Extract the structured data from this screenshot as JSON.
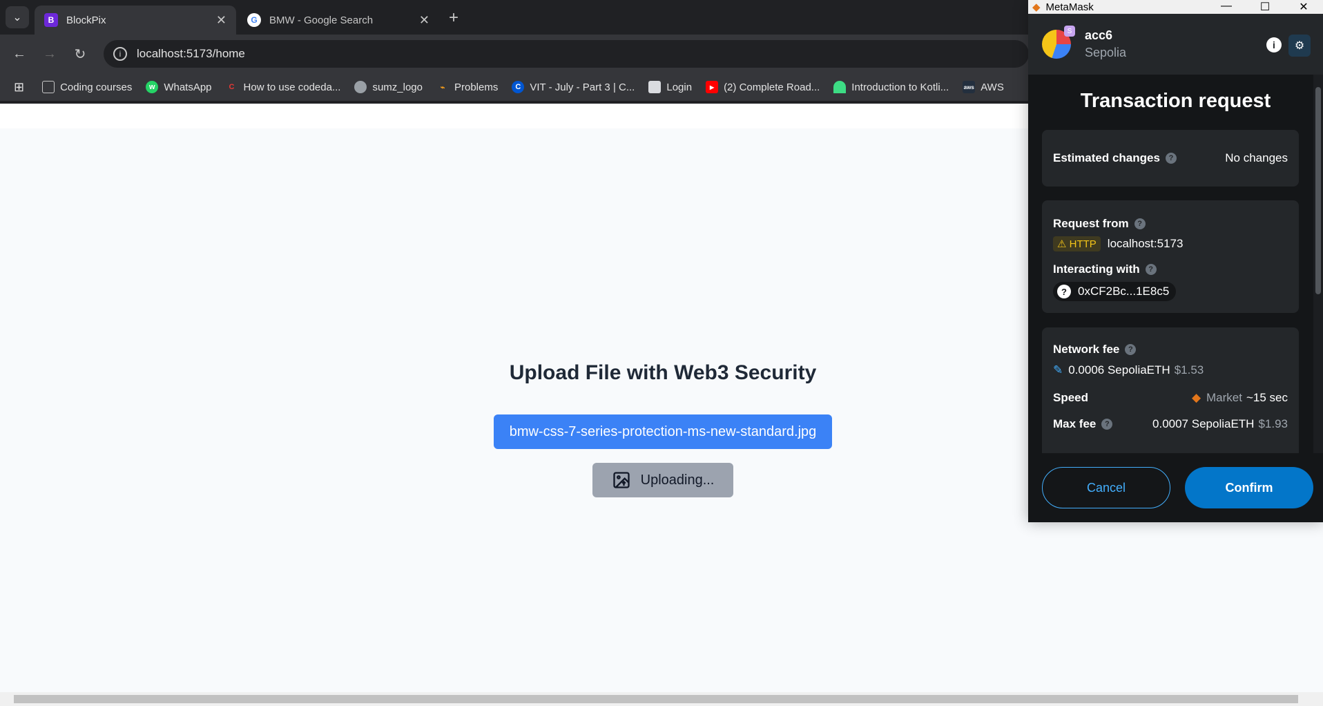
{
  "browser": {
    "tabs": [
      {
        "label": "BlockPix",
        "active": true
      },
      {
        "label": "BMW - Google Search",
        "active": false
      }
    ],
    "url": "localhost:5173/home",
    "bookmarks": [
      {
        "label": "Coding courses",
        "icon": "folder-icon"
      },
      {
        "label": "WhatsApp",
        "icon": "whatsapp-icon"
      },
      {
        "label": "How to use codeda...",
        "icon": "codedamn-icon"
      },
      {
        "label": "sumz_logo",
        "icon": "globe-icon"
      },
      {
        "label": "Problems",
        "icon": "leetcode-icon"
      },
      {
        "label": "VIT - July - Part 3 | C...",
        "icon": "coursera-icon"
      },
      {
        "label": "Login",
        "icon": "page-icon"
      },
      {
        "label": "(2) Complete Road...",
        "icon": "youtube-icon"
      },
      {
        "label": "Introduction to Kotli...",
        "icon": "android-icon"
      },
      {
        "label": "AWS",
        "icon": "aws-icon"
      }
    ]
  },
  "page": {
    "title": "Upload File with Web3 Security",
    "file_name": "bmw-css-7-series-protection-ms-new-standard.jpg",
    "upload_label": "Uploading..."
  },
  "metamask": {
    "window_title": "MetaMask",
    "account": "acc6",
    "account_badge": "S",
    "network": "Sepolia",
    "heading": "Transaction request",
    "estimated_changes_label": "Estimated changes",
    "estimated_changes_value": "No changes",
    "request_from_label": "Request from",
    "http_badge": "HTTP",
    "request_from_value": "localhost:5173",
    "interacting_with_label": "Interacting with",
    "interacting_with_value": "0xCF2Bc...1E8c5",
    "network_fee_label": "Network fee",
    "network_fee_value": "0.0006 SepoliaETH",
    "network_fee_fiat": "$1.53",
    "speed_label": "Speed",
    "speed_value": "Market",
    "speed_time": "~15 sec",
    "max_fee_label": "Max fee",
    "max_fee_value": "0.0007 SepoliaETH",
    "max_fee_fiat": "$1.93",
    "cancel_label": "Cancel",
    "confirm_label": "Confirm",
    "accent": "#0376c9"
  }
}
